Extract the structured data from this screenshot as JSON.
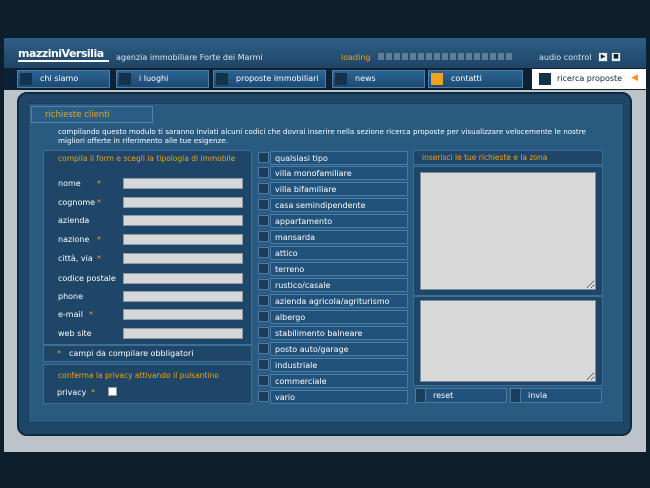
{
  "header": {
    "logo": "mazziniVersilia",
    "tagline": "agenzia immobiliare Forte dei Marmi",
    "loading": "loading",
    "audio": "audio control",
    "audio_play": "▶",
    "audio_stop": "■"
  },
  "nav": {
    "items": [
      "chi siamo",
      "i luoghi",
      "proposte immobiliari",
      "news",
      "contatti"
    ],
    "search": "ricerca proposte",
    "search_arrow": "◀"
  },
  "form": {
    "title": "richieste clienti",
    "intro": "compilando questo modulo ti saranno inviati alcuni codici che dovrai inserire nella sezione ricerca proposte per visualizzare velocemente le nostre migliori offerte in riferimento alle tue esigenze.",
    "left_title": "compila il form e scegli la tipologia di immobile",
    "fields": [
      {
        "label": "nome",
        "required": "*"
      },
      {
        "label": "cognome",
        "required": "*"
      },
      {
        "label": "azienda",
        "required": ""
      },
      {
        "label": "nazione",
        "required": "*"
      },
      {
        "label": "città, via",
        "required": "*"
      },
      {
        "label": "codice postale",
        "required": ""
      },
      {
        "label": "phone",
        "required": ""
      },
      {
        "label": "e-mail",
        "required": "*"
      },
      {
        "label": "web site",
        "required": ""
      }
    ],
    "required_note_star": "*",
    "required_note": "campi da compilare obbligatori",
    "privacy_title": "conferma la privacy attivando il pulsantino",
    "privacy_label": "privacy",
    "privacy_star": "*",
    "property_types": [
      "qualsiasi tipo",
      "villa monofamiliare",
      "villa bifamiliare",
      "casa semindipendente",
      "appartamento",
      "mansarda",
      "attico",
      "terreno",
      "rustico/casale",
      "azienda agricola/agriturismo",
      "albergo",
      "stabilimento balneare",
      "posto auto/garage",
      "industriale",
      "commerciale",
      "vario"
    ],
    "right_title": "inserisci le tue richieste e la zona",
    "reset": "reset",
    "submit": "invia"
  },
  "colors": {
    "accent": "#f0a21b",
    "panel": "#295b81",
    "background": "#0d1e2c"
  }
}
